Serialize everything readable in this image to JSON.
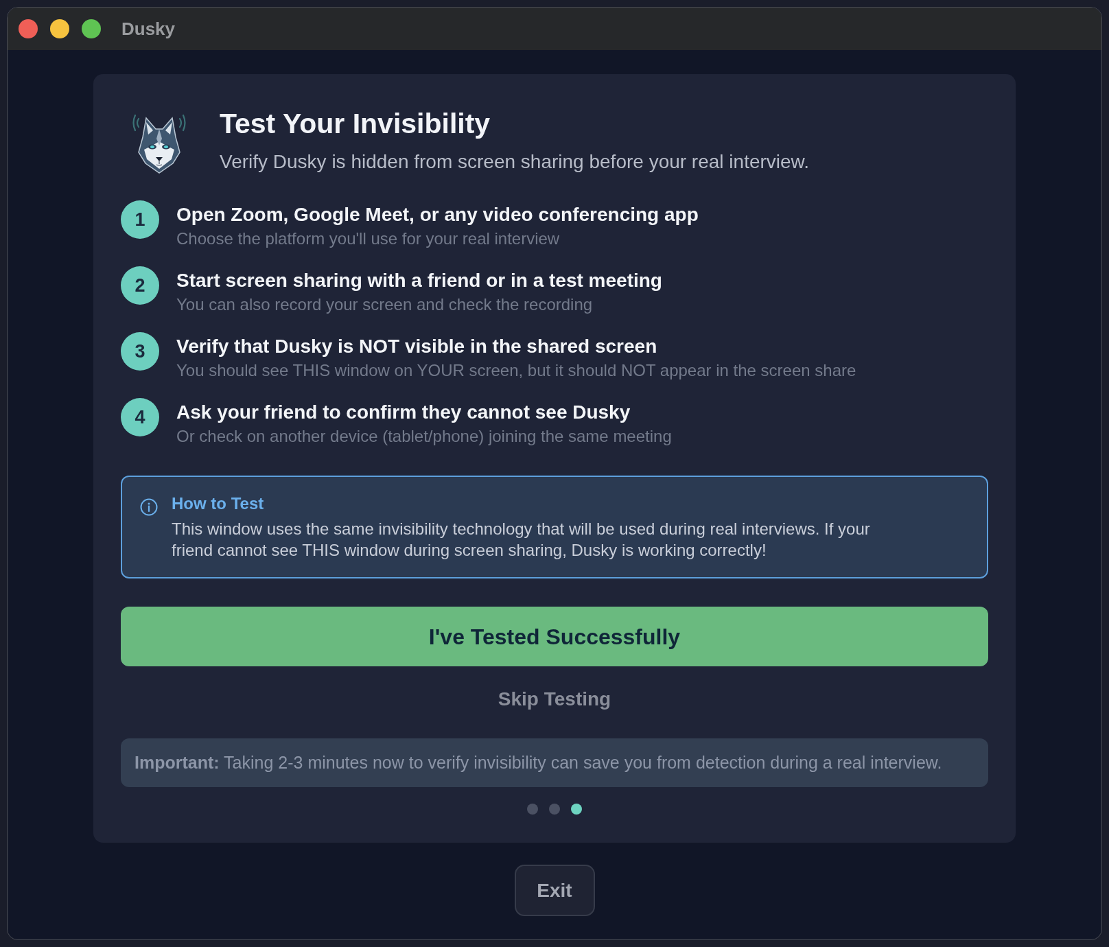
{
  "window": {
    "title": "Dusky"
  },
  "header": {
    "title": "Test Your Invisibility",
    "subtitle": "Verify Dusky is hidden from screen sharing before your real interview."
  },
  "steps": [
    {
      "number": "1",
      "title": "Open Zoom, Google Meet, or any video conferencing app",
      "description": "Choose the platform you'll use for your real interview"
    },
    {
      "number": "2",
      "title": "Start screen sharing with a friend or in a test meeting",
      "description": "You can also record your screen and check the recording"
    },
    {
      "number": "3",
      "title": "Verify that Dusky is NOT visible in the shared screen",
      "description": "You should see THIS window on YOUR screen, but it should NOT appear in the screen share"
    },
    {
      "number": "4",
      "title": "Ask your friend to confirm they cannot see Dusky",
      "description": "Or check on another device (tablet/phone) joining the same meeting"
    }
  ],
  "info_box": {
    "title": "How to Test",
    "text": "This window uses the same invisibility technology that will be used during real interviews. If your friend cannot see THIS window during screen sharing, Dusky is working correctly!"
  },
  "primary_button": {
    "label": "I've Tested Successfully"
  },
  "skip_button": {
    "label": "Skip Testing"
  },
  "important_note": {
    "text": "**Important:** Taking 2-3 minutes now to verify invisibility can save you from detection during a real interview."
  },
  "pagination": [
    {
      "selected": false
    },
    {
      "selected": false
    },
    {
      "selected": true
    }
  ],
  "exit_button": {
    "label": "Exit"
  }
}
